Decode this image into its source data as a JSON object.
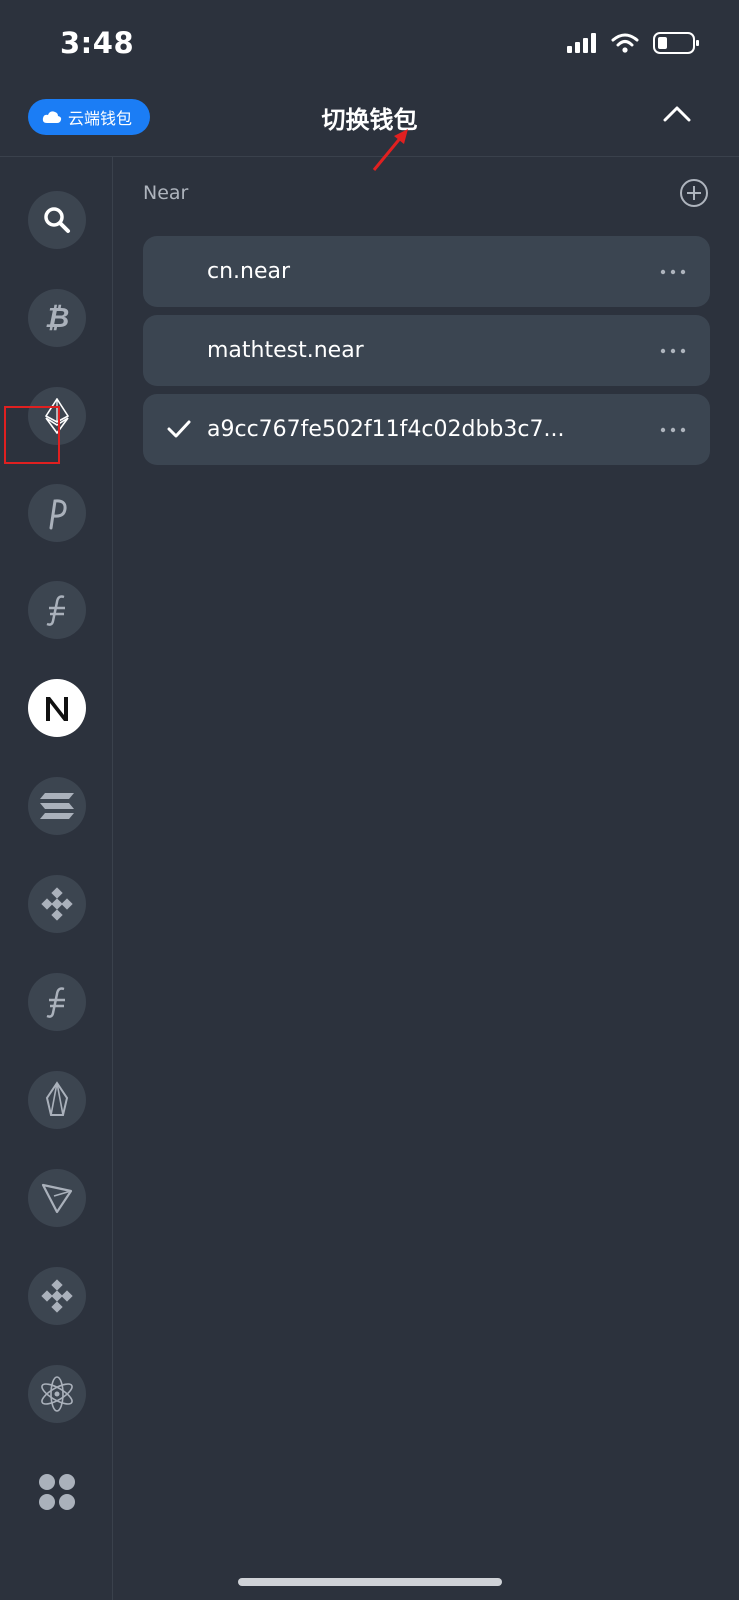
{
  "status_bar": {
    "time": "3:48"
  },
  "header": {
    "cloud_wallet_label": "云端钱包",
    "title": "切换钱包"
  },
  "sidebar": {
    "chains": [
      {
        "icon": "search-icon"
      },
      {
        "icon": "bitcoin-icon"
      },
      {
        "icon": "ethereum-icon"
      },
      {
        "icon": "polkadot-icon"
      },
      {
        "icon": "filecoin-icon"
      },
      {
        "icon": "near-icon",
        "active": true
      },
      {
        "icon": "solana-icon"
      },
      {
        "icon": "binance-icon"
      },
      {
        "icon": "filecoin-icon"
      },
      {
        "icon": "eos-icon"
      },
      {
        "icon": "tron-icon"
      },
      {
        "icon": "binance-icon"
      },
      {
        "icon": "cosmos-icon"
      },
      {
        "icon": "more-apps-icon"
      }
    ]
  },
  "content": {
    "section_label": "Near",
    "wallets": [
      {
        "name": "cn.near",
        "selected": false
      },
      {
        "name": "mathtest.near",
        "selected": false
      },
      {
        "name": "a9cc767fe502f11f4c02dbb3c7...",
        "selected": true
      }
    ]
  },
  "colors": {
    "background": "#2c323d",
    "card": "#3b4551",
    "accent": "#1b7df5",
    "annotation": "#e02020"
  }
}
